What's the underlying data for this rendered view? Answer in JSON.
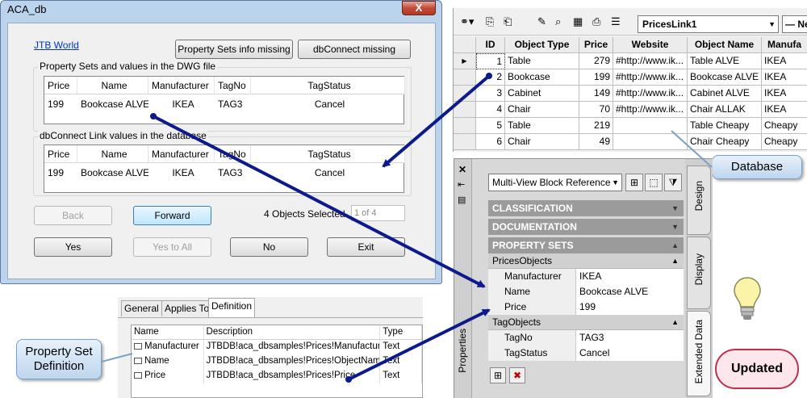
{
  "dialog": {
    "title": "ACA_db",
    "close_glyph": "X",
    "link": "JTB World",
    "btn_ps_missing": "Property Sets info missing",
    "btn_dbc_missing": "dbConnect missing",
    "group1_label": "Property Sets and values in the DWG file",
    "group2_label": "dbConnect Link values in the database",
    "columns": [
      "Price",
      "Name",
      "Manufacturer",
      "TagNo",
      "TagStatus"
    ],
    "dwg_row": [
      "199",
      "Bookcase ALVE",
      "IKEA",
      "TAG3",
      "Cancel"
    ],
    "db_row": [
      "199",
      "Bookcase ALVE",
      "IKEA",
      "TAG3",
      "Cancel"
    ],
    "btn_back": "Back",
    "btn_forward": "Forward",
    "objects_selected": "4 Objects Selected",
    "counter": "1 of 4",
    "btn_yes": "Yes",
    "btn_yes_all": "Yes to All",
    "btn_no": "No",
    "btn_exit": "Exit"
  },
  "database": {
    "link_select": "PricesLink1",
    "second_select": "Ne",
    "columns": [
      "ID",
      "Object Type",
      "Price",
      "Website",
      "Object Name",
      "Manufa"
    ],
    "rows": [
      [
        "1",
        "Table",
        "279",
        "#http://www.ik...",
        "Table ALVE",
        "IKEA"
      ],
      [
        "2",
        "Bookcase",
        "199",
        "#http://www.ik...",
        "Bookcase ALVE",
        "IKEA"
      ],
      [
        "3",
        "Cabinet",
        "149",
        "#http://www.ik...",
        "Cabinet ALVE",
        "IKEA"
      ],
      [
        "4",
        "Chair",
        "70",
        "#http://www.ik...",
        "Chair ALLAK",
        "IKEA"
      ],
      [
        "5",
        "Table",
        "219",
        "",
        "Table Cheapy",
        "Cheapy"
      ],
      [
        "6",
        "Chair",
        "49",
        "",
        "Chair Cheapy",
        "Cheapy"
      ]
    ],
    "current_row_marker": "▶"
  },
  "callouts": {
    "database": "Database",
    "property_set_definition": "Property Set Definition",
    "updated": "Updated"
  },
  "palette": {
    "object_select": "Multi-View Block Reference",
    "side_label": "Properties",
    "sections": [
      "CLASSIFICATION",
      "DOCUMENTATION",
      "PROPERTY SETS"
    ],
    "prices_objects": "PricesObjects",
    "prices_props": [
      {
        "key": "Manufacturer",
        "value": "IKEA"
      },
      {
        "key": "Name",
        "value": "Bookcase ALVE"
      },
      {
        "key": "Price",
        "value": "199"
      }
    ],
    "tag_objects": "TagObjects",
    "tag_props": [
      {
        "key": "TagNo",
        "value": "TAG3"
      },
      {
        "key": "TagStatus",
        "value": "Cancel"
      }
    ],
    "tabs": [
      "Design",
      "Display",
      "Extended Data"
    ]
  },
  "definition": {
    "tabs": [
      "General",
      "Applies To",
      "Definition"
    ],
    "columns": [
      "Name",
      "Description",
      "Type"
    ],
    "rows": [
      [
        "Manufacturer",
        "JTBDB!aca_dbsamples!Prices!Manufacturer",
        "Text"
      ],
      [
        "Name",
        "JTBDB!aca_dbsamples!Prices!ObjectName",
        "Text"
      ],
      [
        "Price",
        "JTBDB!aca_dbsamples!Prices!Price",
        "Text"
      ]
    ]
  },
  "colors": {
    "arrow": "#0d1a8c",
    "dialog_frame": "#bcd3ec",
    "section_header": "#9b9b9b",
    "cloud_border": "#c0304a"
  }
}
